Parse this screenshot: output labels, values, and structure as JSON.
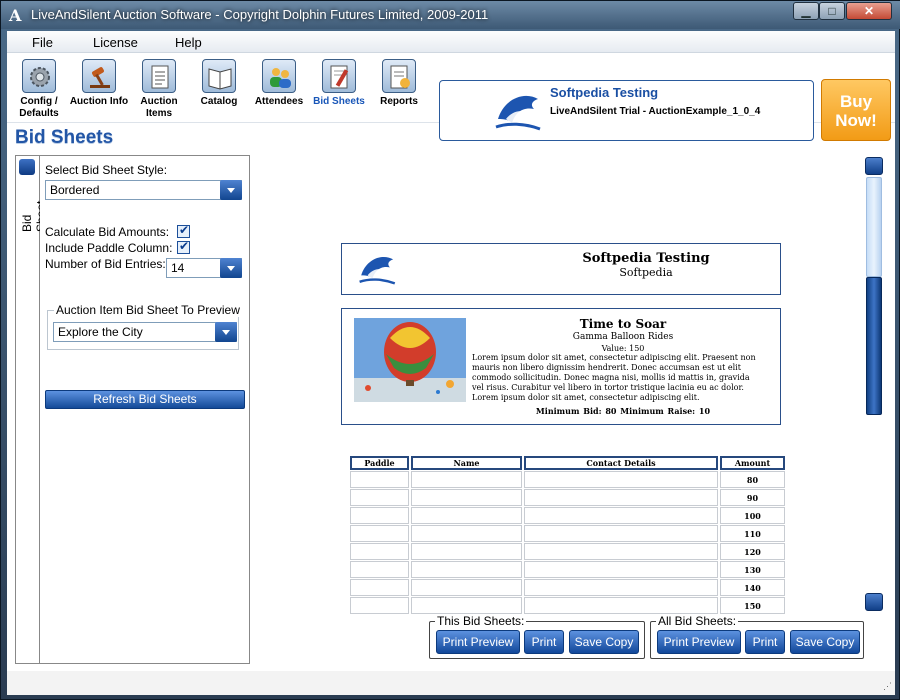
{
  "window": {
    "title": "LiveAndSilent Auction Software - Copyright Dolphin Futures Limited, 2009-2011",
    "app_icon": "A",
    "minimize_glyph": "▁",
    "maximize_glyph": "□",
    "close_glyph": "✕"
  },
  "menu": {
    "file": "File",
    "license": "License",
    "help": "Help"
  },
  "toolbar": {
    "config": "Config / Defaults",
    "auction_info": "Auction Info",
    "auction_items": "Auction Items",
    "catalog": "Catalog",
    "attendees": "Attendees",
    "bid_sheets": "Bid Sheets",
    "reports": "Reports",
    "active": "Bid Sheets"
  },
  "banner": {
    "title": "Softpedia Testing",
    "subtitle": "LiveAndSilent Trial - AuctionExample_1_0_4"
  },
  "buy_now": {
    "line1": "Buy",
    "line2": "Now!"
  },
  "page_heading": "Bid Sheets",
  "left_tab": {
    "label": "Bid Sheet"
  },
  "options": {
    "style_label": "Select Bid Sheet Style:",
    "style_value": "Bordered",
    "calc_label": "Calculate Bid Amounts:",
    "calc_checked": true,
    "paddle_label": "Include Paddle Column:",
    "paddle_checked": true,
    "entries_label": "Number of Bid Entries:",
    "entries_value": "14",
    "preview_group_label": "Auction Item Bid Sheet To Preview",
    "preview_item_value": "Explore the City",
    "refresh_label": "Refresh Bid Sheets"
  },
  "sheet": {
    "header_title": "Softpedia Testing",
    "header_subtitle": "Softpedia",
    "item_title": "Time to Soar",
    "item_subtitle": "Gamma Balloon Rides",
    "item_value": "Value: 150",
    "item_description": "Lorem ipsum dolor sit amet, consectetur adipiscing elit. Praesent non mauris non libero dignissim hendrerit. Donec accumsan est ut elit commodo sollicitudin. Donec magna nisi, mollis id mattis in, gravida vel risus. Curabitur vel libero in tortor tristique lacinia eu ac dolor. Lorem ipsum dolor sit amet, consectetur adipiscing elit.",
    "item_minimums": "Minimum Bid: 80    Minimum Raise: 10",
    "columns": [
      "Paddle",
      "Name",
      "Contact Details",
      "Amount"
    ],
    "amounts": [
      "80",
      "90",
      "100",
      "110",
      "120",
      "130",
      "140",
      "150"
    ]
  },
  "actions": {
    "this_label": "This Bid Sheets:",
    "all_label": "All Bid Sheets:",
    "print_preview": "Print Preview",
    "print": "Print",
    "save_copy": "Save Copy"
  },
  "colors": {
    "accent": "#2356a6",
    "button": "#134a98",
    "buy_now": "#f29b16"
  },
  "icons": {
    "config": "gears-icon",
    "auction_info": "gavel-icon",
    "auction_items": "document-list-icon",
    "catalog": "open-book-icon",
    "attendees": "people-icon",
    "bid_sheets": "pencil-sheet-icon",
    "reports": "report-icon",
    "logo": "dolphin-logo-icon"
  }
}
